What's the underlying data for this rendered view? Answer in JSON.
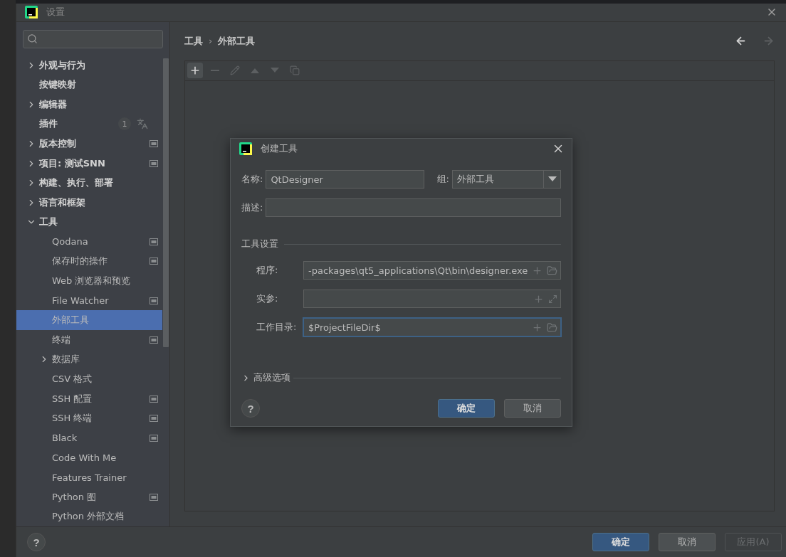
{
  "window": {
    "title": "设置"
  },
  "sidebar": {
    "items": [
      {
        "label": "外观与行为",
        "kind": "group",
        "expanded": false,
        "selected": false,
        "project_scoped": false
      },
      {
        "label": "按键映射",
        "kind": "page",
        "selected": false,
        "project_scoped": false
      },
      {
        "label": "编辑器",
        "kind": "group",
        "expanded": false,
        "selected": false,
        "project_scoped": false
      },
      {
        "label": "插件",
        "kind": "page",
        "selected": false,
        "project_scoped": false,
        "badge": "1"
      },
      {
        "label": "版本控制",
        "kind": "group",
        "expanded": false,
        "selected": false,
        "project_scoped": true
      },
      {
        "label": "项目: 测试SNN",
        "kind": "group",
        "expanded": false,
        "selected": false,
        "project_scoped": true
      },
      {
        "label": "构建、执行、部署",
        "kind": "group",
        "expanded": false,
        "selected": false,
        "project_scoped": false
      },
      {
        "label": "语言和框架",
        "kind": "group",
        "expanded": false,
        "selected": false,
        "project_scoped": false
      },
      {
        "label": "工具",
        "kind": "group",
        "expanded": true,
        "selected": false,
        "project_scoped": false,
        "children": [
          {
            "label": "Qodana",
            "kind": "page",
            "selected": false,
            "project_scoped": true
          },
          {
            "label": "保存时的操作",
            "kind": "page",
            "selected": false,
            "project_scoped": true
          },
          {
            "label": "Web 浏览器和预览",
            "kind": "page",
            "selected": false,
            "project_scoped": false
          },
          {
            "label": "File Watcher",
            "kind": "page",
            "selected": false,
            "project_scoped": true
          },
          {
            "label": "外部工具",
            "kind": "page",
            "selected": true,
            "project_scoped": false
          },
          {
            "label": "终端",
            "kind": "page",
            "selected": false,
            "project_scoped": true
          },
          {
            "label": "数据库",
            "kind": "group",
            "expanded": false,
            "selected": false,
            "project_scoped": false
          },
          {
            "label": "CSV 格式",
            "kind": "page",
            "selected": false,
            "project_scoped": false
          },
          {
            "label": "SSH 配置",
            "kind": "page",
            "selected": false,
            "project_scoped": true
          },
          {
            "label": "SSH 终端",
            "kind": "page",
            "selected": false,
            "project_scoped": true
          },
          {
            "label": "Black",
            "kind": "page",
            "selected": false,
            "project_scoped": true
          },
          {
            "label": "Code With Me",
            "kind": "page",
            "selected": false,
            "project_scoped": false
          },
          {
            "label": "Features Trainer",
            "kind": "page",
            "selected": false,
            "project_scoped": false
          },
          {
            "label": "Python 图",
            "kind": "page",
            "selected": false,
            "project_scoped": true
          },
          {
            "label": "Python 外部文档",
            "kind": "page",
            "selected": false,
            "project_scoped": false
          }
        ]
      }
    ]
  },
  "breadcrumb": {
    "items": [
      "工具",
      "外部工具"
    ],
    "separator": "›"
  },
  "nav": {
    "back": {
      "disabled": false
    },
    "forward": {
      "disabled": true
    }
  },
  "toolbar": [
    {
      "kind": "add",
      "disabled": false,
      "hovered": true
    },
    {
      "kind": "remove",
      "disabled": true,
      "hovered": false
    },
    {
      "kind": "edit",
      "disabled": true,
      "hovered": false
    },
    {
      "kind": "up",
      "disabled": true,
      "hovered": false
    },
    {
      "kind": "down",
      "disabled": true,
      "hovered": false
    },
    {
      "kind": "copy",
      "disabled": true,
      "hovered": false
    }
  ],
  "dialog": {
    "title": "创建工具",
    "name": {
      "label": "名称:",
      "value": "QtDesigner"
    },
    "group": {
      "label": "组:",
      "value": "外部工具"
    },
    "description": {
      "label": "描述:"
    },
    "section": "工具设置",
    "tool_fields": [
      {
        "label": "程序:",
        "value": "-packages\\qt5_applications\\Qt\\bin\\designer.exe",
        "kind": "browse",
        "focused": false
      },
      {
        "label": "实参:",
        "kind": "expand",
        "focused": false
      },
      {
        "label": "工作目录:",
        "value": "$ProjectFileDir$",
        "kind": "browse",
        "focused": true
      }
    ],
    "advanced": {
      "label": "高级选项",
      "expanded": false
    },
    "help": "?",
    "buttons": [
      {
        "label": "确定",
        "primary": true
      },
      {
        "label": "取消",
        "primary": false
      }
    ]
  },
  "help": "?",
  "footer": {
    "buttons": [
      {
        "label": "确定",
        "primary": true,
        "disabled": false
      },
      {
        "label": "取消",
        "primary": false,
        "disabled": false
      },
      {
        "label": "应用(A)",
        "primary": false,
        "disabled": true
      }
    ]
  }
}
